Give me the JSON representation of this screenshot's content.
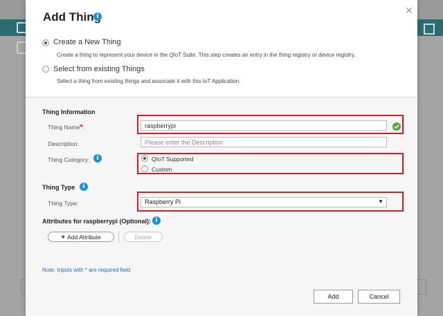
{
  "modal": {
    "title": "Add Thing",
    "options": [
      {
        "label": "Create a New Thing",
        "description": "Create a thing to represent your device in the QIoT Suite. This step creates an entry in the thing registry or device registry.",
        "checked": true
      },
      {
        "label": "Select from existing Things",
        "description": "Select a thing from existing things and associate it with this IoT Application.",
        "checked": false
      }
    ],
    "thing_information": {
      "title": "Thing Information",
      "name_label": "Thing Name",
      "required_mark": "*",
      "name_colon": ":",
      "name_value": "raspberrypi",
      "description_label": "Description:",
      "description_placeholder": "Please enter the Description",
      "category_label": "Thing Category:",
      "category_options": [
        {
          "label": "QIoT Supported",
          "checked": true
        },
        {
          "label": "Custom",
          "checked": false
        }
      ]
    },
    "thing_type": {
      "title": "Thing Type",
      "label": "Thing Type:",
      "selected": "Raspberry Pi"
    },
    "attributes": {
      "title": "Attributes for raspberrypi (Optional):",
      "add_label": "Add Attribute",
      "delete_label": "Delete"
    },
    "note": "Note: Inputs with * are required field",
    "add_button": "Add",
    "cancel_button": "Cancel"
  },
  "colors": {
    "accent": "#1f8fd8",
    "highlight": "#d31e29",
    "success": "#5aa53a",
    "header_strip": "#2a6c70"
  }
}
